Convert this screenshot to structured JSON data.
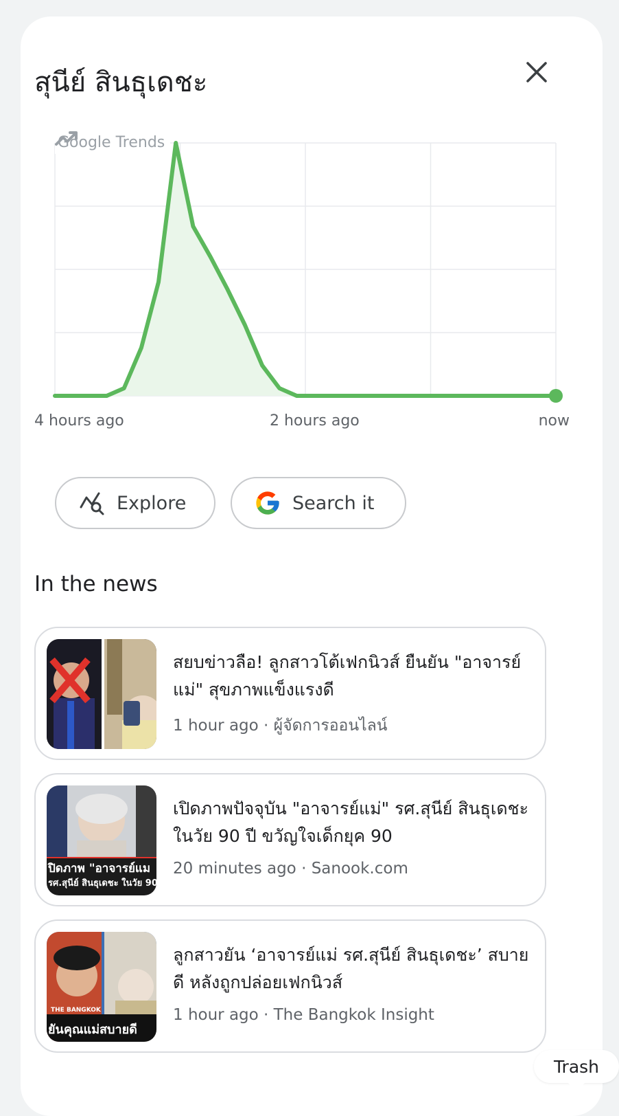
{
  "header": {
    "title": "สุนีย์ สินธุเดชะ"
  },
  "chart_badge": "Google Trends",
  "chart_data": {
    "type": "area",
    "xlabels": [
      "4 hours ago",
      "2 hours ago",
      "now"
    ],
    "grid": true,
    "ylim": [
      0,
      100
    ],
    "values": [
      0,
      0,
      0,
      0,
      3,
      19,
      45,
      100,
      67,
      55,
      42,
      28,
      12,
      3,
      0,
      0,
      0,
      0,
      0,
      0,
      0,
      0,
      0,
      0,
      0,
      0,
      0,
      0,
      0,
      0
    ],
    "line_color": "#5cb85c",
    "fill_color": "#eaf6ea",
    "last_point_marker": true
  },
  "actions": {
    "explore_label": "Explore",
    "search_label": "Search it"
  },
  "news": {
    "section_title": "In the news",
    "items": [
      {
        "headline": "สยบข่าวลือ! ลูกสาวโต้เฟกนิวส์ ยืนยัน \"อาจารย์แม่\" สุขภาพแข็งแรงดี",
        "time": "1 hour ago",
        "source": "ผู้จัดการออนไลน์",
        "meta": "1 hour ago · ผู้จัดการออนไลน์"
      },
      {
        "headline": "เปิดภาพปัจจุบัน \"อาจารย์แม่\" รศ.สุนีย์ สินธุเดชะ ในวัย 90 ปี ขวัญใจเด็กยุค 90",
        "time": "20 minutes ago",
        "source": "Sanook.com",
        "meta": "20 minutes ago · Sanook.com",
        "thumb_text": [
          "ปิดภาพ \"อาจารย์แม",
          "รศ.สุนีย์ สินธุเดชะ ในวัย 90"
        ]
      },
      {
        "headline": "ลูกสาวยัน ‘อาจารย์แม่ รศ.สุนีย์ สินธุเดชะ’ สบายดี หลังถูกปล่อยเฟกนิวส์",
        "time": "1 hour ago",
        "source": "The Bangkok Insight",
        "meta": "1 hour ago · The Bangkok Insight",
        "thumb_text": [
          "THE BANGKOK",
          "ยันคุณแม่สบายดี"
        ]
      }
    ]
  },
  "tooltip": {
    "label": "Trash"
  },
  "colors": {
    "background": "#f1f3f4",
    "panel": "#ffffff",
    "line": "#5cb85c",
    "muted_text": "#5f6368"
  }
}
